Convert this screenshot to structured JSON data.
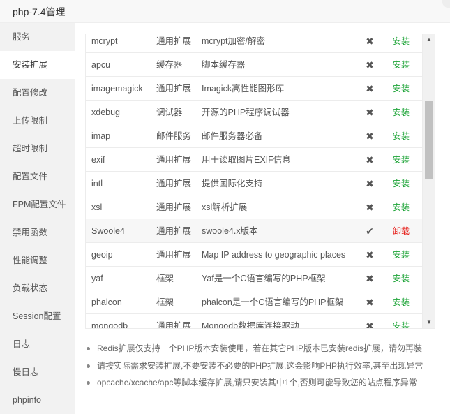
{
  "window": {
    "title": "php-7.4管理"
  },
  "sidebar": {
    "items": [
      {
        "label": "服务"
      },
      {
        "label": "安装扩展"
      },
      {
        "label": "配置修改"
      },
      {
        "label": "上传限制"
      },
      {
        "label": "超时限制"
      },
      {
        "label": "配置文件"
      },
      {
        "label": "FPM配置文件"
      },
      {
        "label": "禁用函数"
      },
      {
        "label": "性能调整"
      },
      {
        "label": "负载状态"
      },
      {
        "label": "Session配置"
      },
      {
        "label": "日志"
      },
      {
        "label": "慢日志"
      },
      {
        "label": "phpinfo"
      }
    ],
    "active_index": 1
  },
  "extensions": {
    "rows": [
      {
        "name": "mcrypt",
        "type": "通用扩展",
        "desc": "mcrypt加密/解密",
        "status_icon": "✖",
        "action": "安装",
        "installed": false
      },
      {
        "name": "apcu",
        "type": "缓存器",
        "desc": "脚本缓存器",
        "status_icon": "✖",
        "action": "安装",
        "installed": false
      },
      {
        "name": "imagemagick",
        "type": "通用扩展",
        "desc": "Imagick高性能图形库",
        "status_icon": "✖",
        "action": "安装",
        "installed": false
      },
      {
        "name": "xdebug",
        "type": "调试器",
        "desc": "开源的PHP程序调试器",
        "status_icon": "✖",
        "action": "安装",
        "installed": false
      },
      {
        "name": "imap",
        "type": "邮件服务",
        "desc": "邮件服务器必备",
        "status_icon": "✖",
        "action": "安装",
        "installed": false
      },
      {
        "name": "exif",
        "type": "通用扩展",
        "desc": "用于读取图片EXIF信息",
        "status_icon": "✖",
        "action": "安装",
        "installed": false
      },
      {
        "name": "intl",
        "type": "通用扩展",
        "desc": "提供国际化支持",
        "status_icon": "✖",
        "action": "安装",
        "installed": false
      },
      {
        "name": "xsl",
        "type": "通用扩展",
        "desc": "xsl解析扩展",
        "status_icon": "✖",
        "action": "安装",
        "installed": false
      },
      {
        "name": "Swoole4",
        "type": "通用扩展",
        "desc": "swoole4.x版本",
        "status_icon": "✔",
        "action": "卸载",
        "installed": true
      },
      {
        "name": "geoip",
        "type": "通用扩展",
        "desc": "Map IP address to geographic places",
        "status_icon": "✖",
        "action": "安装",
        "installed": false
      },
      {
        "name": "yaf",
        "type": "框架",
        "desc": "Yaf是一个C语言编写的PHP框架",
        "status_icon": "✖",
        "action": "安装",
        "installed": false
      },
      {
        "name": "phalcon",
        "type": "框架",
        "desc": "phalcon是一个C语言编写的PHP框架",
        "status_icon": "✖",
        "action": "安装",
        "installed": false
      },
      {
        "name": "mongodb",
        "type": "通用扩展",
        "desc": "Mongodb数据库连接驱动",
        "status_icon": "✖",
        "action": "安装",
        "installed": false
      }
    ]
  },
  "scrollbar": {
    "up_icon": "▲",
    "down_icon": "▼"
  },
  "notes": [
    "Redis扩展仅支持一个PHP版本安装使用，若在其它PHP版本已安装redis扩展，请勿再装",
    "请按实际需求安装扩展,不要安装不必要的PHP扩展,这会影响PHP执行效率,甚至出现异常",
    "opcache/xcache/apc等脚本缓存扩展,请只安装其中1个,否则可能导致您的站点程序异常"
  ],
  "colors": {
    "install": "#20a53a",
    "uninstall": "#e5120c",
    "sidebar_bg": "#f2f2f2"
  }
}
